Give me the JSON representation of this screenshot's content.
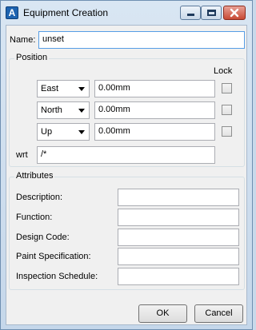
{
  "window": {
    "title": "Equipment Creation",
    "app_icon_letter": "A"
  },
  "name_row": {
    "label": "Name:",
    "value": "unset"
  },
  "position": {
    "legend": "Position",
    "lock_header": "Lock",
    "rows": [
      {
        "direction": "East",
        "value": "0.00mm",
        "locked": false
      },
      {
        "direction": "North",
        "value": "0.00mm",
        "locked": false
      },
      {
        "direction": "Up",
        "value": "0.00mm",
        "locked": false
      }
    ],
    "wrt_label": "wrt",
    "wrt_value": "/*"
  },
  "attributes": {
    "legend": "Attributes",
    "fields": [
      {
        "label": "Description:",
        "value": ""
      },
      {
        "label": "Function:",
        "value": ""
      },
      {
        "label": "Design Code:",
        "value": ""
      },
      {
        "label": "Paint Specification:",
        "value": ""
      },
      {
        "label": "Inspection Schedule:",
        "value": ""
      }
    ]
  },
  "buttons": {
    "ok": "OK",
    "cancel": "Cancel"
  }
}
